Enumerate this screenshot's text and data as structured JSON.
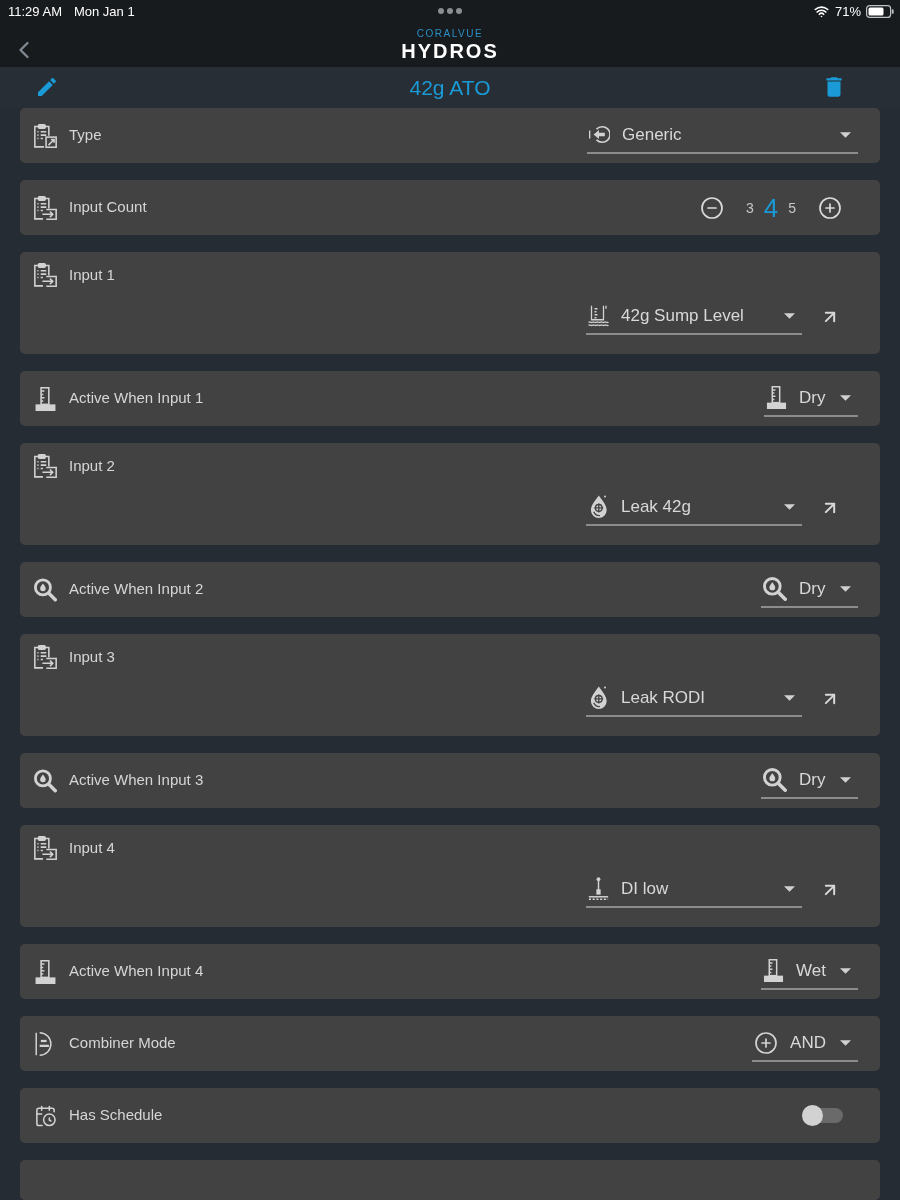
{
  "status_bar": {
    "time": "11:29 AM",
    "date": "Mon Jan 1",
    "battery": "71%"
  },
  "nav": {
    "logo_subtitle": "CORALVUE",
    "logo_title": "HYDROS"
  },
  "header": {
    "title": "42g ATO"
  },
  "rows": [
    {
      "kind": "select",
      "label": "Type",
      "value": "Generic"
    },
    {
      "kind": "stepper",
      "label": "Input Count",
      "options": [
        {
          "label": "3",
          "selected": false
        },
        {
          "label": "4",
          "selected": true
        },
        {
          "label": "5",
          "selected": false
        }
      ]
    },
    {
      "kind": "input",
      "label": "Input 1",
      "value": "42g Sump Level"
    },
    {
      "kind": "choice",
      "label": "Active When Input 1",
      "value": "Dry"
    },
    {
      "kind": "input",
      "label": "Input 2",
      "value": "Leak 42g"
    },
    {
      "kind": "choice",
      "label": "Active When Input 2",
      "value": "Dry"
    },
    {
      "kind": "input",
      "label": "Input 3",
      "value": "Leak RODI"
    },
    {
      "kind": "choice",
      "label": "Active When Input 3",
      "value": "Dry"
    },
    {
      "kind": "input",
      "label": "Input 4",
      "value": "DI low"
    },
    {
      "kind": "choice",
      "label": "Active When Input 4",
      "value": "Wet"
    },
    {
      "kind": "choice",
      "label": "Combiner Mode",
      "value": "AND"
    },
    {
      "kind": "toggle",
      "label": "Has Schedule",
      "on": false
    }
  ]
}
